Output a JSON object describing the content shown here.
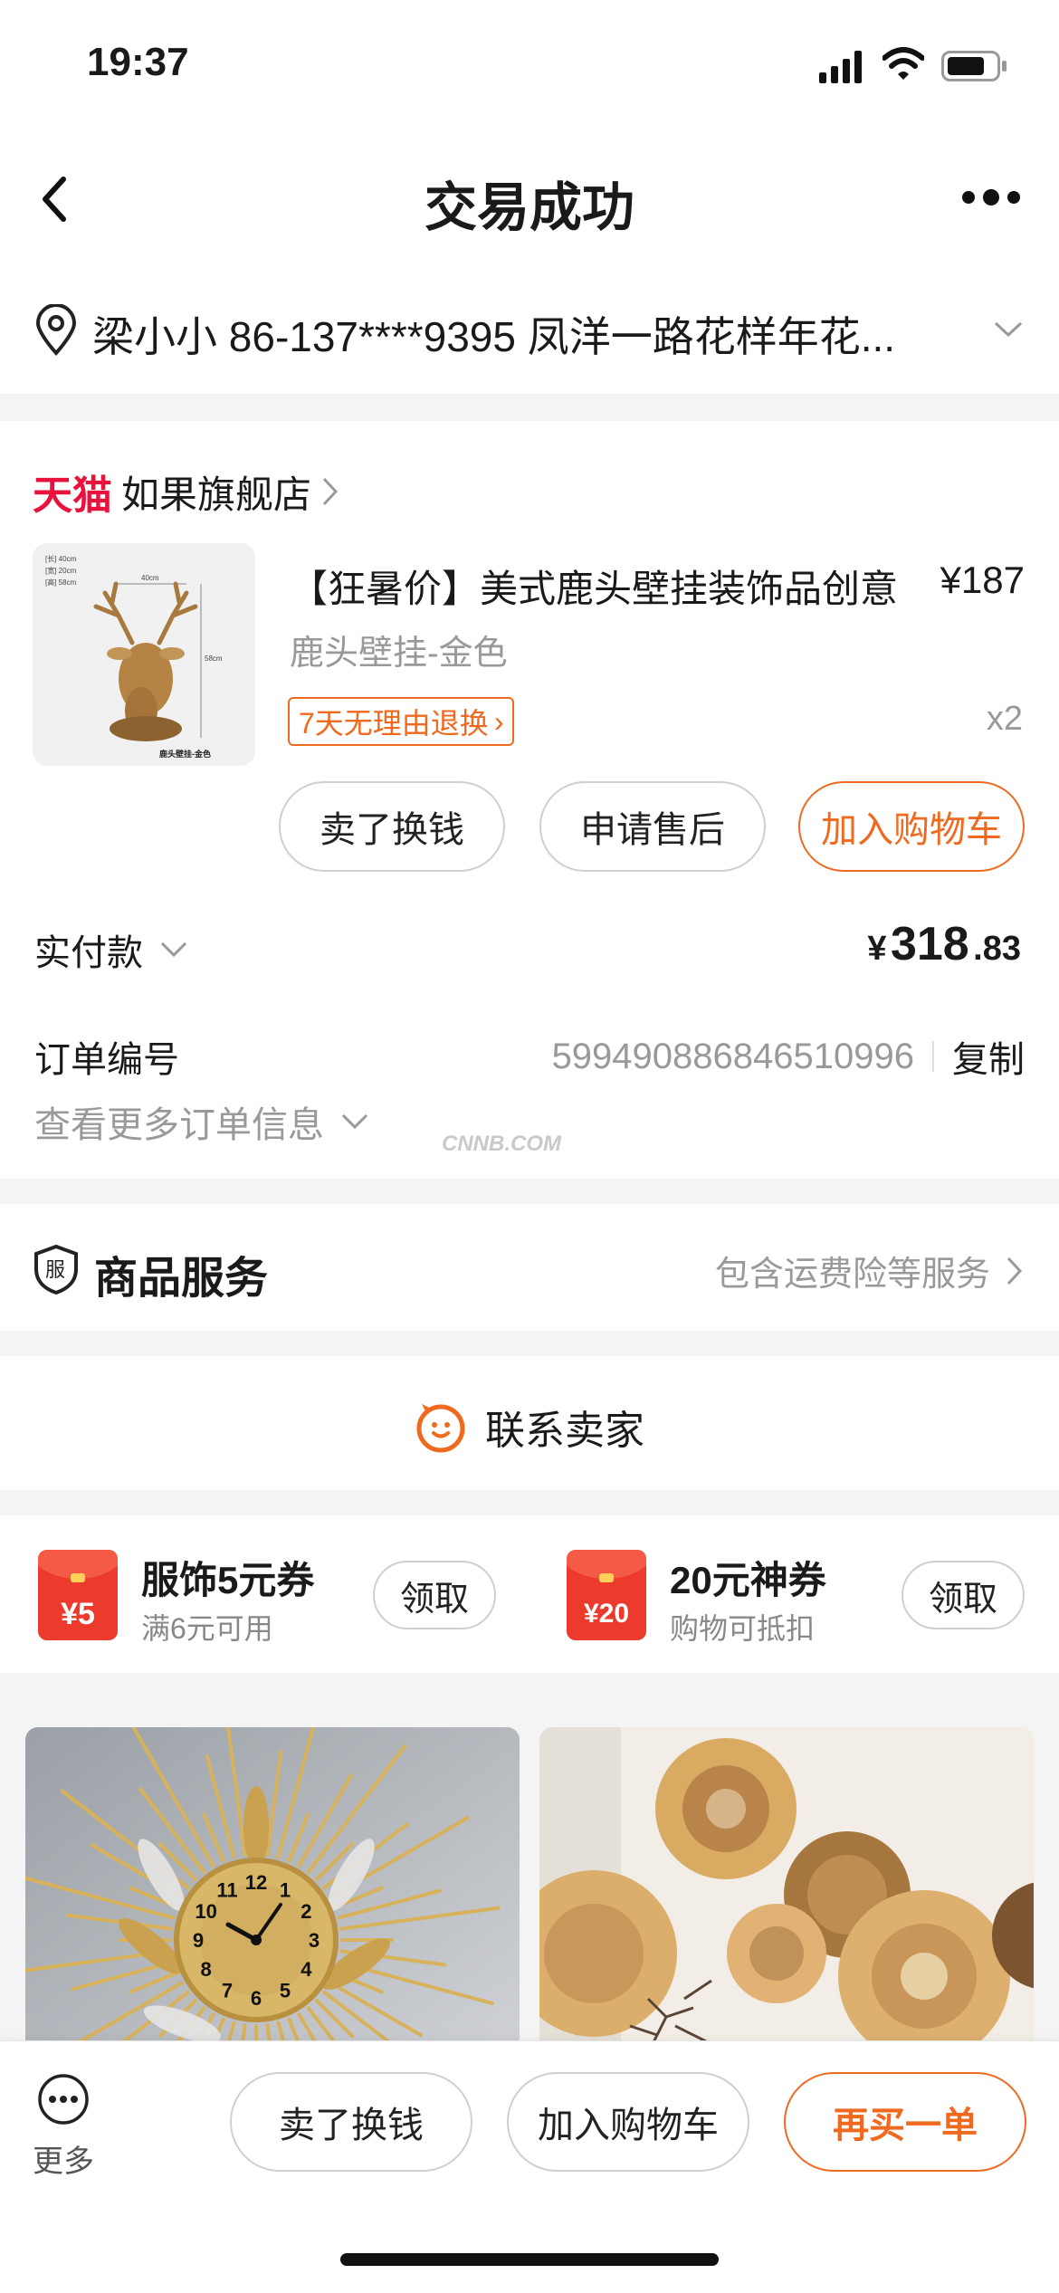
{
  "status_bar": {
    "time": "19:37"
  },
  "nav": {
    "title": "交易成功"
  },
  "address": {
    "text": "梁小小  86-137****9395  凤洋一路花样年花..."
  },
  "store": {
    "brand": "天猫",
    "name": "如果旗舰店"
  },
  "product": {
    "image_labels": {
      "l1": "[长] 40cm",
      "l2": "[宽] 20cm",
      "l3": "[高] 58cm",
      "w": "40cm",
      "h": "58cm",
      "caption": "鹿头壁挂-金色"
    },
    "title": "【狂暑价】美式鹿头壁挂装饰品创意",
    "price": "¥187",
    "sku": "鹿头壁挂-金色",
    "return_tag": "7天无理由退换",
    "quantity": "x2",
    "actions": [
      "卖了换钱",
      "申请售后",
      "加入购物车"
    ]
  },
  "payment": {
    "label": "实付款",
    "currency": "¥",
    "amount_int": "318",
    "amount_dec": ".83"
  },
  "order": {
    "label": "订单编号",
    "number": "5994908868465109­96",
    "copy": "复制",
    "more": "查看更多订单信息",
    "watermark": "CNNB.COM"
  },
  "service": {
    "title": "商品服务",
    "desc": "包含运费险等服务"
  },
  "contact": {
    "label": "联系卖家"
  },
  "coupons": [
    {
      "amount": "¥5",
      "title": "服饰5元券",
      "subtitle": "满6元可用",
      "button": "领取"
    },
    {
      "amount": "¥20",
      "title": "20元神券",
      "subtitle": "购物可抵扣",
      "button": "领取"
    }
  ],
  "clock_numbers": [
    "12",
    "1",
    "2",
    "3",
    "4",
    "5",
    "6",
    "7",
    "8",
    "9",
    "10",
    "11"
  ],
  "bottom_bar": {
    "more": "更多",
    "actions": [
      "卖了换钱",
      "加入购物车",
      "再买一单"
    ]
  },
  "colors": {
    "accent": "#ef6a1f",
    "tmall": "#e8123c",
    "muted": "#999999"
  }
}
